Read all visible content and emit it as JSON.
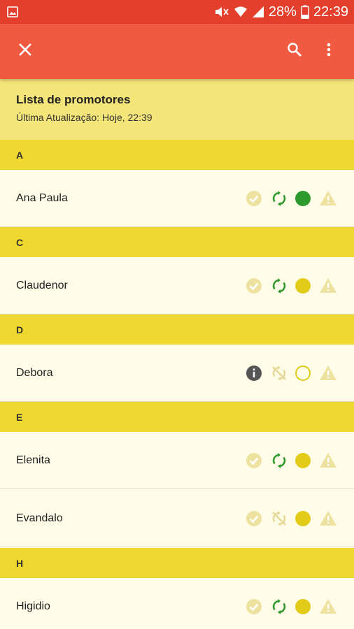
{
  "status_bar": {
    "battery": "28%",
    "time": "22:39"
  },
  "header": {
    "title": "Lista de promotores",
    "subtitle": "Última Atualização: Hoje, 22:39"
  },
  "colors": {
    "app_bar": "#ef5a40",
    "status_bar": "#e43f2d",
    "section": "#efd82f",
    "header_bg": "#f4e57a",
    "green": "#2e9a2e",
    "yellow": "#e3cb1a"
  },
  "sections": [
    {
      "letter": "A",
      "items": [
        {
          "name": "Ana Paula",
          "check": "faded-check",
          "sync": "sync-active",
          "status": "green-dot",
          "alert": "faded-warning"
        }
      ]
    },
    {
      "letter": "C",
      "items": [
        {
          "name": "Claudenor",
          "check": "faded-check",
          "sync": "sync-active",
          "status": "yellow-dot",
          "alert": "faded-warning"
        }
      ]
    },
    {
      "letter": "D",
      "items": [
        {
          "name": "Debora",
          "check": "info",
          "sync": "sync-disabled",
          "status": "empty-dot",
          "alert": "faded-warning"
        }
      ]
    },
    {
      "letter": "E",
      "items": [
        {
          "name": "Elenita",
          "check": "faded-check",
          "sync": "sync-active",
          "status": "yellow-dot",
          "alert": "faded-warning"
        },
        {
          "name": "Evandalo",
          "check": "faded-check",
          "sync": "sync-disabled",
          "status": "yellow-dot",
          "alert": "faded-warning"
        }
      ]
    },
    {
      "letter": "H",
      "items": [
        {
          "name": "Higidio",
          "check": "faded-check",
          "sync": "sync-active",
          "status": "yellow-dot",
          "alert": "faded-warning"
        }
      ]
    }
  ]
}
